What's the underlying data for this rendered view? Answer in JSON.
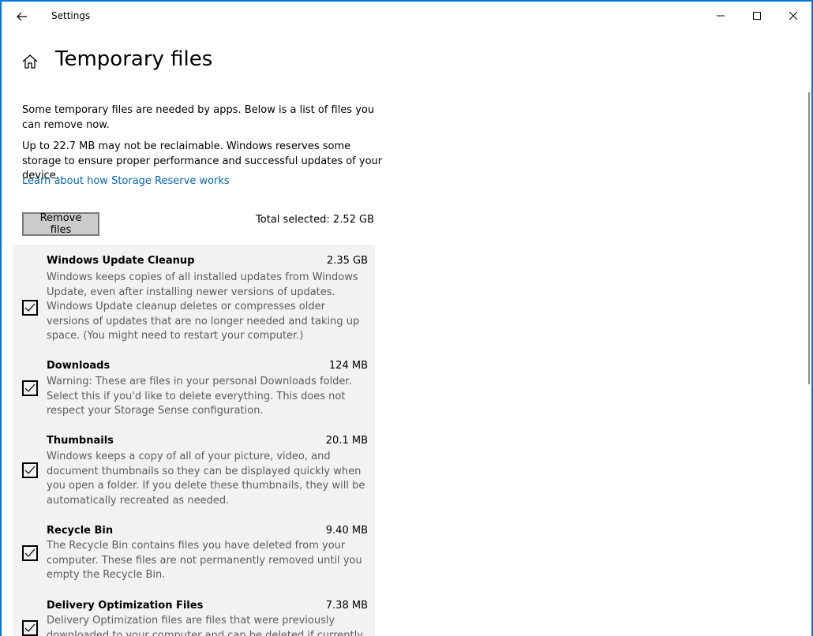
{
  "window": {
    "title": "Settings",
    "accent": "#0078d7"
  },
  "header": {
    "title": "Temporary files"
  },
  "intro": {
    "para1": "Some temporary files are needed by apps. Below is a list of files you can remove now.",
    "para2": "Up to 22.7 MB may not be reclaimable. Windows reserves some storage to ensure proper performance and successful updates of your device.",
    "link": "Learn about how Storage Reserve works"
  },
  "actions": {
    "remove_label": "Remove files",
    "total_selected": "Total selected: 2.52 GB"
  },
  "items": [
    {
      "name": "Windows Update Cleanup",
      "size": "2.35 GB",
      "checked": true,
      "description": "Windows keeps copies of all installed updates from Windows Update, even after installing newer versions of updates. Windows Update cleanup deletes or compresses older versions of updates that are no longer needed and taking up space. (You might need to restart your computer.)"
    },
    {
      "name": "Downloads",
      "size": "124 MB",
      "checked": true,
      "description": "Warning: These are files in your personal Downloads folder. Select this if you'd like to delete everything. This does not respect your Storage Sense configuration."
    },
    {
      "name": "Thumbnails",
      "size": "20.1 MB",
      "checked": true,
      "description": "Windows keeps a copy of all of your picture, video, and document thumbnails so they can be displayed quickly when you open a folder. If you delete these thumbnails, they will be automatically recreated as needed."
    },
    {
      "name": "Recycle Bin",
      "size": "9.40 MB",
      "checked": true,
      "description": "The Recycle Bin contains files you have deleted from your computer. These files are not permanently removed until you empty the Recycle Bin."
    },
    {
      "name": "Delivery Optimization Files",
      "size": "7.38 MB",
      "checked": true,
      "description": "Delivery Optimization files are files that were previously downloaded to your computer and can be deleted if currently"
    }
  ],
  "icons": {
    "back": "back-arrow-icon",
    "home": "home-icon",
    "minimize": "minimize-icon",
    "maximize": "maximize-icon",
    "close": "close-icon",
    "check": "checkmark-icon"
  }
}
